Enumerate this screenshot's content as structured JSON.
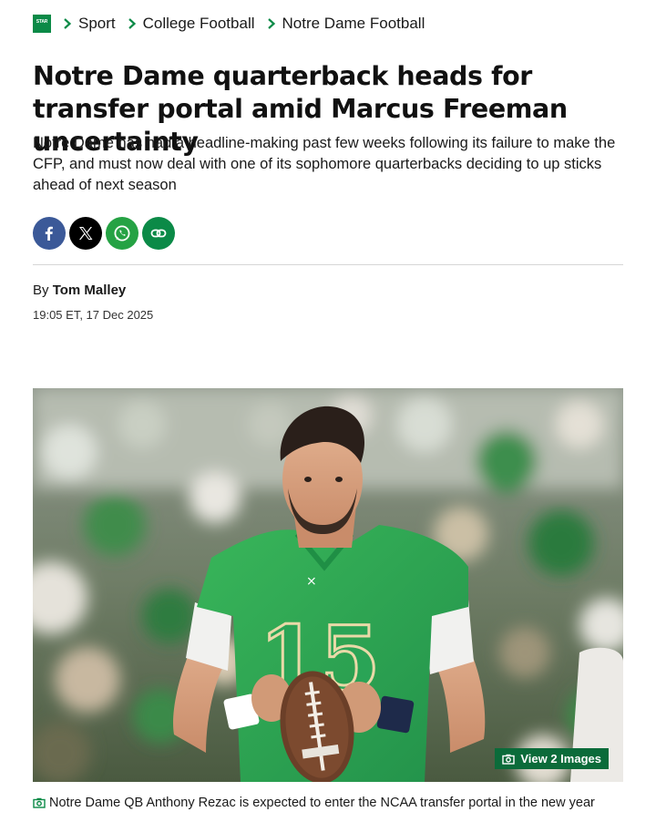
{
  "breadcrumb": {
    "logo_text": "STAR",
    "items": [
      {
        "label": "Sport"
      },
      {
        "label": "College Football"
      },
      {
        "label": "Notre Dame Football"
      }
    ]
  },
  "article": {
    "headline": "Notre Dame quarterback heads for transfer portal amid Marcus Freeman uncertainty",
    "standfirst": "Notre Dame has had a headline-making past few weeks following its failure to make the CFP, and must now deal with one of its sophomore quarterbacks deciding to up sticks ahead of next season",
    "byline_prefix": "By",
    "author": "Tom Malley",
    "timestamp": "19:05 ET, 17 Dec 2025"
  },
  "share": {
    "buttons": [
      {
        "icon": "facebook-icon",
        "color": "#3b5998"
      },
      {
        "icon": "x-icon",
        "color": "#000000"
      },
      {
        "icon": "whatsapp-icon",
        "color": "#25a244"
      },
      {
        "icon": "link-icon",
        "color": "#0b8a47"
      }
    ]
  },
  "hero": {
    "view_images_label": "View 2 Images",
    "jersey_number": "15",
    "caption": "Notre Dame QB Anthony Rezac is expected to enter the NCAA transfer portal in the new year"
  },
  "colors": {
    "brand_green": "#0b8a47",
    "view_badge": "#0b6b3a"
  }
}
